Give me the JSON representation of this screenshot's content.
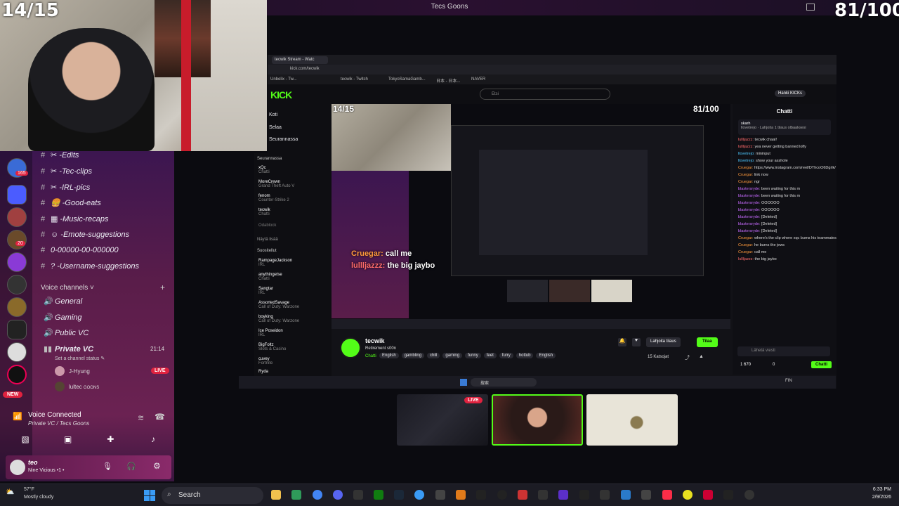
{
  "window": {
    "title": "Tecs Goons"
  },
  "overlay": {
    "left_counter": "14/15",
    "right_counter": "81/100"
  },
  "discord": {
    "text_channels": [
      {
        "emoji": "✂",
        "name": "-Edits"
      },
      {
        "emoji": "✂",
        "name": "-Tec-clips"
      },
      {
        "emoji": "✂",
        "name": "-IRL-pics"
      },
      {
        "emoji": "🍔",
        "name": "-Good-eats"
      },
      {
        "emoji": "▦",
        "name": "-Music-recaps"
      },
      {
        "emoji": "☺",
        "name": "-Emote-suggestions"
      },
      {
        "emoji": "",
        "name": "0-00000-00-000000"
      },
      {
        "emoji": "?",
        "name": "-Username-suggestions"
      }
    ],
    "voice_header": "Voice channels",
    "voice_channels": [
      "General",
      "Gaming",
      "Public VC"
    ],
    "private_vc": {
      "name": "Private VC",
      "time": "21:14",
      "status_placeholder": "Set a channel status"
    },
    "vc_members": [
      {
        "name": "J-Hyung",
        "badge": "LIVE"
      },
      {
        "name": "lultec",
        "tag": "GOONS"
      }
    ],
    "badges": {
      "mentions": "165",
      "unread1": "20",
      "new": "NEW"
    },
    "voice_connected": {
      "title": "Voice Connected",
      "subtitle": "Private VC / Tecs Goons"
    },
    "user": {
      "name": "teo",
      "status": "Nine Vicious •1 •"
    }
  },
  "browser": {
    "tab_title": "tecwik Stream - Watc",
    "url": "kick.com/tecwik",
    "bookmarks": [
      "Unbelix - Tw...",
      "tecwik - Twitch",
      "TokyoSamaGamb...",
      "日本 - 日本...",
      "NAVER"
    ],
    "search_placeholder": "Etsi",
    "get_kicks": "Hanki KICKs",
    "nav": [
      "Koti",
      "Selaa",
      "Seurannassa"
    ],
    "following_header": "Seurannassa",
    "following": [
      {
        "name": "xQc",
        "game": "Chatti",
        "viewers": "81 t"
      },
      {
        "name": "MoreCrewn",
        "game": "Grand Theft Auto V",
        "viewers": "421"
      },
      {
        "name": "fenom",
        "game": "Counter-Strike 2",
        "viewers": "81 t"
      },
      {
        "name": "tecwik",
        "game": "Chatti",
        "viewers": "15"
      },
      {
        "name": "Odablock",
        "game": "",
        "viewers": ""
      }
    ],
    "show_more": "Näytä lisää",
    "recommended_header": "Suositellut",
    "recommended": [
      {
        "name": "RampageJackson",
        "game": "IRL",
        "viewers": "81 t"
      },
      {
        "name": "anythingelse",
        "game": "Chatti",
        "viewers": "963"
      },
      {
        "name": "Sangtar",
        "game": "IRL",
        "viewers": "81 t"
      },
      {
        "name": "AssortedSavage",
        "game": "Call of Duty: Warzone",
        "viewers": "36"
      },
      {
        "name": "boyking",
        "game": "Call of Duty: Warzone",
        "viewers": "81 t"
      },
      {
        "name": "Ice Poseidon",
        "game": "IRL",
        "viewers": "9,7 t"
      },
      {
        "name": "BigFoltz",
        "game": "Slots & Casino",
        "viewers": "614"
      },
      {
        "name": "cuvey",
        "game": "Fortnite",
        "viewers": "256"
      },
      {
        "name": "Ryda",
        "game": "",
        "viewers": ""
      }
    ],
    "streamer": {
      "name": "tecwik",
      "title": "Retirement s00n",
      "category": "Chatti",
      "tags": [
        "English",
        "gambling",
        "chill",
        "gaming",
        "funny",
        "feet",
        "furry",
        "hottub",
        "English"
      ],
      "subscribe_gift": "Lahjoita tilaus",
      "subscribe": "Tilaa",
      "viewers": "15 Katsojat"
    },
    "chat": {
      "header": "Chatti",
      "pinned_user": "skarh",
      "pinned_text": "llovetrejo · Lahjoita 1 tilaus olbaaksesi",
      "lines": [
        {
          "user": "lullljazzz:",
          "text": "tecwik chaal!",
          "color": "#ff6b6b"
        },
        {
          "user": "lullljazzz:",
          "text": "yea never getting banned lolfy",
          "color": "#ff6b6b"
        },
        {
          "user": "llovetrejo:",
          "text": "mininput",
          "color": "#4ec9ff"
        },
        {
          "user": "llovetrejo:",
          "text": "show your asshole",
          "color": "#4ec9ff"
        },
        {
          "user": "Cruegar:",
          "text": "https://www.instagram.com/reel/DThcoO6Dgrlk/",
          "color": "#ff9a3c"
        },
        {
          "user": "Cruegar:",
          "text": "link now",
          "color": "#ff9a3c"
        },
        {
          "user": "Cruegar:",
          "text": "ngr",
          "color": "#ff9a3c"
        },
        {
          "user": "blastersryde:",
          "text": "been waiting for this m",
          "color": "#c86bff"
        },
        {
          "user": "blastersryde:",
          "text": "been waiting for this m",
          "color": "#c86bff"
        },
        {
          "user": "blastersryde:",
          "text": "OOOOOO",
          "color": "#c86bff"
        },
        {
          "user": "blastersryde:",
          "text": "OOOOOO",
          "color": "#c86bff"
        },
        {
          "user": "blastersryde:",
          "text": "[Deleted]",
          "color": "#c86bff"
        },
        {
          "user": "blastersryde:",
          "text": "[Deleted]",
          "color": "#c86bff"
        },
        {
          "user": "blastersryde:",
          "text": "[Deleted]",
          "color": "#c86bff"
        },
        {
          "user": "Cruegar:",
          "text": "where's the clip where xqc burns his teammates",
          "color": "#ff9a3c"
        },
        {
          "user": "Cruegar:",
          "text": "he burns the jews",
          "color": "#ff9a3c"
        },
        {
          "user": "Cruegar:",
          "text": "call me",
          "color": "#ff9a3c"
        },
        {
          "user": "lullljazzz:",
          "text": "the big jaybo",
          "color": "#ff6b6b"
        }
      ],
      "input_placeholder": "Lähetä viesti",
      "points": "1 670",
      "count": "0",
      "send": "Chatti"
    },
    "stream_overlay_chat": [
      {
        "user": "Cruegar:",
        "text": "call me"
      },
      {
        "user": "lullljazzz:",
        "text": "the big jaybo"
      }
    ],
    "inner_taskbar_search": "搜索",
    "inner_locale": "FIN"
  },
  "thumbs": {
    "live": "LIVE"
  },
  "taskbar": {
    "weather_temp": "57°F",
    "weather_text": "Mostly cloudy",
    "search": "Search",
    "time": "6:33 PM",
    "date": "2/9/2026"
  },
  "colors": {
    "kick_green": "#53fc18",
    "live_red": "#e0223f",
    "discord_purple": "#5a1d4a"
  }
}
